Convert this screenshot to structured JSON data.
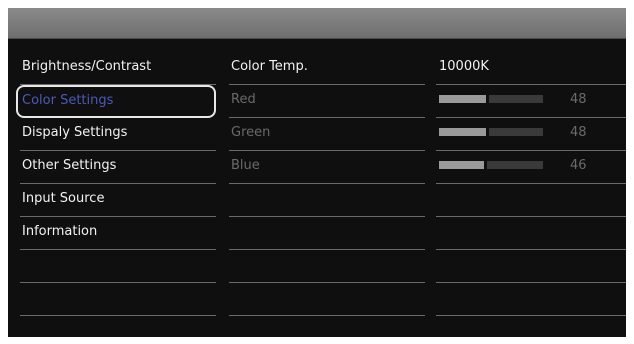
{
  "menu": {
    "items": [
      {
        "label": "Brightness/Contrast"
      },
      {
        "label": "Color Settings"
      },
      {
        "label": "Dispaly Settings"
      },
      {
        "label": "Other Settings"
      },
      {
        "label": "Input Source"
      },
      {
        "label": "Information"
      }
    ]
  },
  "submenu": {
    "items": [
      {
        "label": "Color Temp."
      },
      {
        "label": "Red"
      },
      {
        "label": "Green"
      },
      {
        "label": "Blue"
      }
    ]
  },
  "values": {
    "color_temp": "10000K",
    "red": {
      "value": "48",
      "level": 0.48
    },
    "green": {
      "value": "48",
      "level": 0.48
    },
    "blue": {
      "value": "46",
      "level": 0.46
    }
  },
  "colors": {
    "selected_text": "#4a5ab8",
    "background": "#0f0f0f",
    "header": "#7a7a7a"
  }
}
